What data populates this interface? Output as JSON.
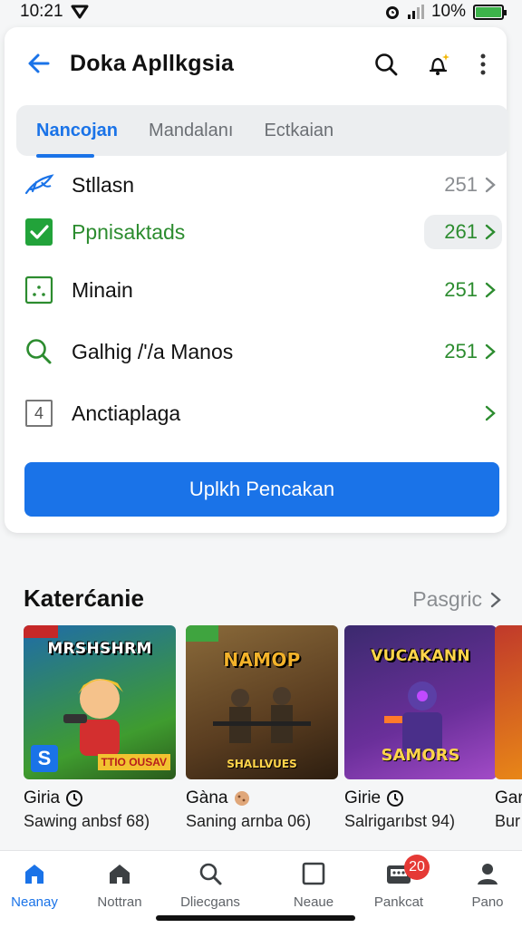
{
  "status_bar": {
    "time": "10:21",
    "battery_text": "10%",
    "battery_level": 0.1
  },
  "app_bar": {
    "title": "Doka Apllkgsia"
  },
  "tabs": [
    {
      "label": "Nancojan",
      "active": true
    },
    {
      "label": "Mandalanı",
      "active": false
    },
    {
      "label": "Ectkaian",
      "active": false
    }
  ],
  "list": [
    {
      "label": "Stllasn",
      "count": "251",
      "icon": "feather-icon"
    },
    {
      "label": "Ppnisaktads",
      "count": "261",
      "icon": "checkbox-icon"
    },
    {
      "label": "Minain",
      "count": "251",
      "icon": "dotted-square-icon"
    },
    {
      "label": "Galhig /'/a Manos",
      "count": "251",
      "icon": "search-icon"
    },
    {
      "label": "Anctiaplaga",
      "count": "",
      "icon": "number-box-icon",
      "icon_text": "4"
    }
  ],
  "primary_button": "Uplkh Pencakan",
  "section": {
    "title": "Katerćanie",
    "link": "Pasgric"
  },
  "games": [
    {
      "thumb_title": "MRSHSHRM",
      "thumb_tag": "TTIO OUSAV",
      "thumb_badge": "S",
      "name": "Giria",
      "meta": "Sawing anbsf 68)",
      "colors": [
        "#1f6ca8",
        "#3f9c2f"
      ]
    },
    {
      "thumb_title": "NAMOP",
      "thumb_tag": "SHALLVUES",
      "thumb_badge": "",
      "name": "Gàna",
      "meta": "Saning arnba 06)",
      "colors": [
        "#6a4a2a",
        "#b97a3a"
      ]
    },
    {
      "thumb_title": "VUCAKANN",
      "thumb_tag": "SAMORS",
      "thumb_badge": "",
      "name": "Girie",
      "meta": "Salrigarıbst 94)",
      "colors": [
        "#3b2a6e",
        "#a24bc7"
      ]
    },
    {
      "thumb_title": "",
      "thumb_tag": "",
      "thumb_badge": "",
      "name": "Gar",
      "meta": "Bur",
      "colors": [
        "#c0392b",
        "#f39c12"
      ]
    }
  ],
  "bottom_nav": [
    {
      "label": "Neanay",
      "icon": "home-filled-icon",
      "active": true
    },
    {
      "label": "Nottran",
      "icon": "home-icon",
      "active": false
    },
    {
      "label": "Dliecgans",
      "icon": "search-icon",
      "active": false
    },
    {
      "label": "Neaue",
      "icon": "square-icon",
      "active": false
    },
    {
      "label": "Pankcat",
      "icon": "inbox-icon",
      "active": false,
      "badge": "20"
    },
    {
      "label": "Pano",
      "icon": "person-icon",
      "active": false
    }
  ],
  "colors": {
    "accent": "#1a73e8",
    "green": "#2c8c2f",
    "badge": "#e53935"
  }
}
